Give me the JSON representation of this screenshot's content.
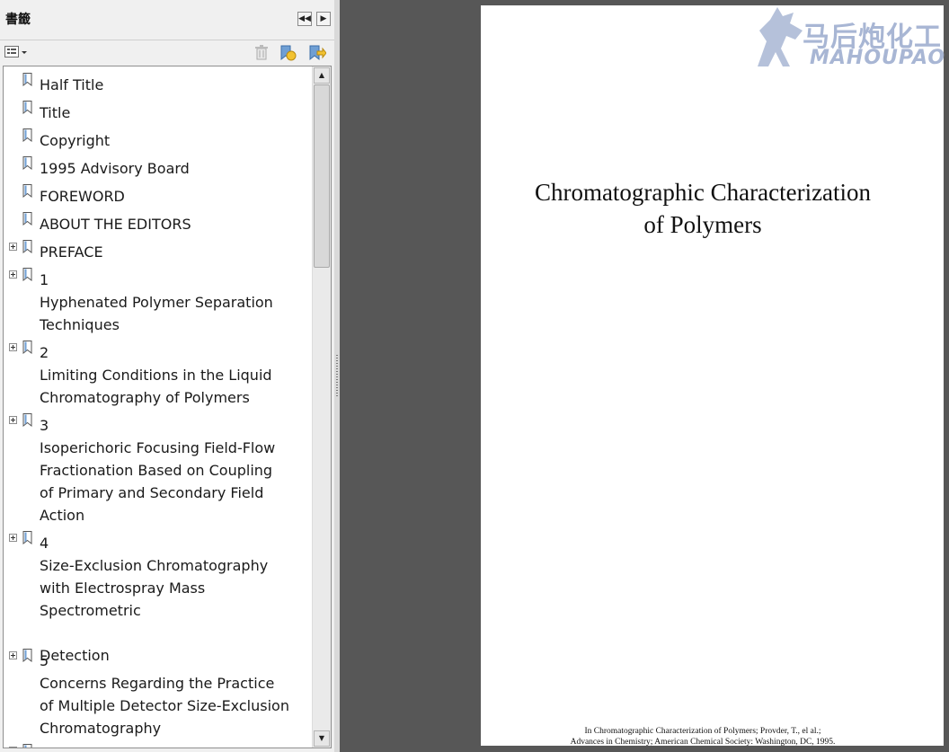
{
  "panel": {
    "title": "書籤",
    "buttons": {
      "collapse": "◀◀",
      "next": "▶"
    },
    "toolbar": {
      "options_icon": "options-menu-icon",
      "delete_icon": "trash-icon",
      "expand_icon": "bookmark-expand-icon",
      "goto_icon": "bookmark-goto-icon"
    }
  },
  "bookmarks": [
    {
      "label": "Half Title",
      "expandable": false
    },
    {
      "label": "Title",
      "expandable": false
    },
    {
      "label": "Copyright",
      "expandable": false
    },
    {
      "label": "1995 Advisory Board",
      "expandable": false
    },
    {
      "label": "FOREWORD",
      "expandable": false
    },
    {
      "label": "ABOUT THE EDITORS",
      "expandable": false
    },
    {
      "label": "PREFACE",
      "expandable": true
    },
    {
      "label": "1\nHyphenated Polymer Separation\nTechniques",
      "expandable": true
    },
    {
      "label": "2\nLimiting Conditions in the Liquid\nChromatography of Polymers",
      "expandable": true
    },
    {
      "label": "3\nIsoperichoric Focusing Field-Flow\nFractionation Based on Coupling\nof Primary and Secondary Field\nAction",
      "expandable": true
    },
    {
      "label": "4\nSize-Exclusion Chromatography\nwith Electrospray Mass Spectrometric\n\nDetection",
      "expandable": true
    },
    {
      "label": "5\nConcerns Regarding the Practice\nof Multiple Detector Size-Exclusion\nChromatography",
      "expandable": true
    },
    {
      "label": "",
      "expandable": true
    }
  ],
  "document": {
    "title": "Chromatographic Characterization\nof Polymers",
    "footer": "In Chromatographic Characterization of Polymers; Provder, T., el al.;\nAdvances in Chemistry; American Chemical Society: Washington, DC, 1995.",
    "watermark_cn": "马后炮化工",
    "watermark_en": "MAHOUPAO"
  }
}
